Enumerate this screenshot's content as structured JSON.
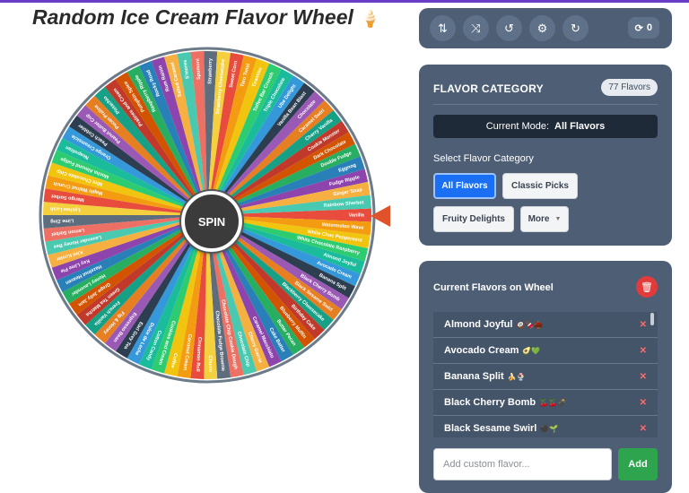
{
  "title": "Random Ice Cream Flavor Wheel",
  "title_icon": "ice-cream-cone-icon",
  "spin_label": "SPIN",
  "toolbar": {
    "buttons": [
      "sort-icon",
      "shuffle-icon",
      "history-icon",
      "settings-icon",
      "reset-icon"
    ],
    "spin_count": "0"
  },
  "category": {
    "heading": "FLAVOR CATEGORY",
    "count_badge": "77 Flavors",
    "mode_label": "Current Mode:",
    "mode_value": "All Flavors",
    "select_label": "Select Flavor Category",
    "buttons": [
      "All Flavors",
      "Classic Picks",
      "Fruity Delights",
      "More"
    ]
  },
  "current": {
    "heading": "Current Flavors on Wheel",
    "items": [
      {
        "name": "Almond Joyful",
        "emoji": "🥥🍫🌰"
      },
      {
        "name": "Avocado Cream",
        "emoji": "🥑💚"
      },
      {
        "name": "Banana Split",
        "emoji": "🍌🍨"
      },
      {
        "name": "Black Cherry Bomb",
        "emoji": "🍒🍒💣"
      },
      {
        "name": "Black Sesame Swirl",
        "emoji": "⚫🌱"
      }
    ],
    "remove_symbol": "✕"
  },
  "add": {
    "placeholder": "Add custom flavor...",
    "button": "Add"
  },
  "wheel": {
    "labels": [
      "Vanilla",
      "Watermelon Wave",
      "White Choc Peppermint",
      "White Chocolate Raspberry",
      "Almond Joyful",
      "Avocado Cream",
      "Banana Split",
      "Black Cherry Bomb",
      "Black Sesame Swirl",
      "Blackberry Cheesecake",
      "Birthday Cake",
      "Blueberry Muffin",
      "Butter Pecan",
      "Cake Batter",
      "Caramel Macchiato",
      "Cherry Garcia",
      "Chocolate Chip",
      "Chocolate Chip Cookie Dough",
      "Chocolate Fudge Brownie",
      "Churro",
      "Cinnamon Roll",
      "Coconut Cream",
      "Coffee",
      "Cookies and Cream",
      "Cotton Candy",
      "Dulce de Leche",
      "Earl Grey Tea",
      "Espresso Bean",
      "Fig & Honey",
      "French Vanilla",
      "Green Tea Matcha",
      "Grape Jelly Jam",
      "Honey Lavender",
      "Hazelnut Heaven",
      "Key Lime Pie",
      "Kiwi Kooler",
      "Lavender Honey Bee",
      "Lemon Sorbet",
      "Lime Zing",
      "Lychee Lush",
      "Mango Sorbet",
      "Maple Walnut Crunch",
      "Mint Chocolate Chip",
      "Mocha Almond Fudge",
      "Neapolitan",
      "Orange Creamsicle",
      "Peach Cobbler",
      "Peanut Butter Cup",
      "Pecan Praline",
      "Pistachio",
      "Pralines and Cream",
      "Pumpkin Spice",
      "Raspberry Ripple",
      "Rocky Road",
      "Rum Raisin",
      "Salted Caramel",
      "S'mores",
      "Spumoni",
      "Strawberry",
      "Strawberry Cheesecake",
      "Sweet Corn",
      "Taro Twist",
      "Tiramisu",
      "Toffee Bar Crunch",
      "Triple Chocolate",
      "Ube Delight",
      "Vanilla Bean Blast",
      "Chocolate",
      "Caramel Swirl",
      "Cherry Vanilla",
      "Cookie Monster",
      "Dark Chocolate",
      "Double Fudge",
      "Eggnog",
      "Fudge Ripple",
      "Ginger Snap",
      "Rainbow Sherbet"
    ],
    "colors": [
      "#e74c3c",
      "#f39c12",
      "#f1c40f",
      "#2ecc71",
      "#1abc9c",
      "#3498db",
      "#2c3e50",
      "#9b59b6",
      "#e67e22",
      "#16a085",
      "#c0392b",
      "#d35400",
      "#27ae60",
      "#2980b9",
      "#8e44ad",
      "#f5b041",
      "#48c9b0",
      "#ec7063",
      "#5d6d7e",
      "#f4d03f"
    ],
    "rim_color": "#6c7a89"
  }
}
